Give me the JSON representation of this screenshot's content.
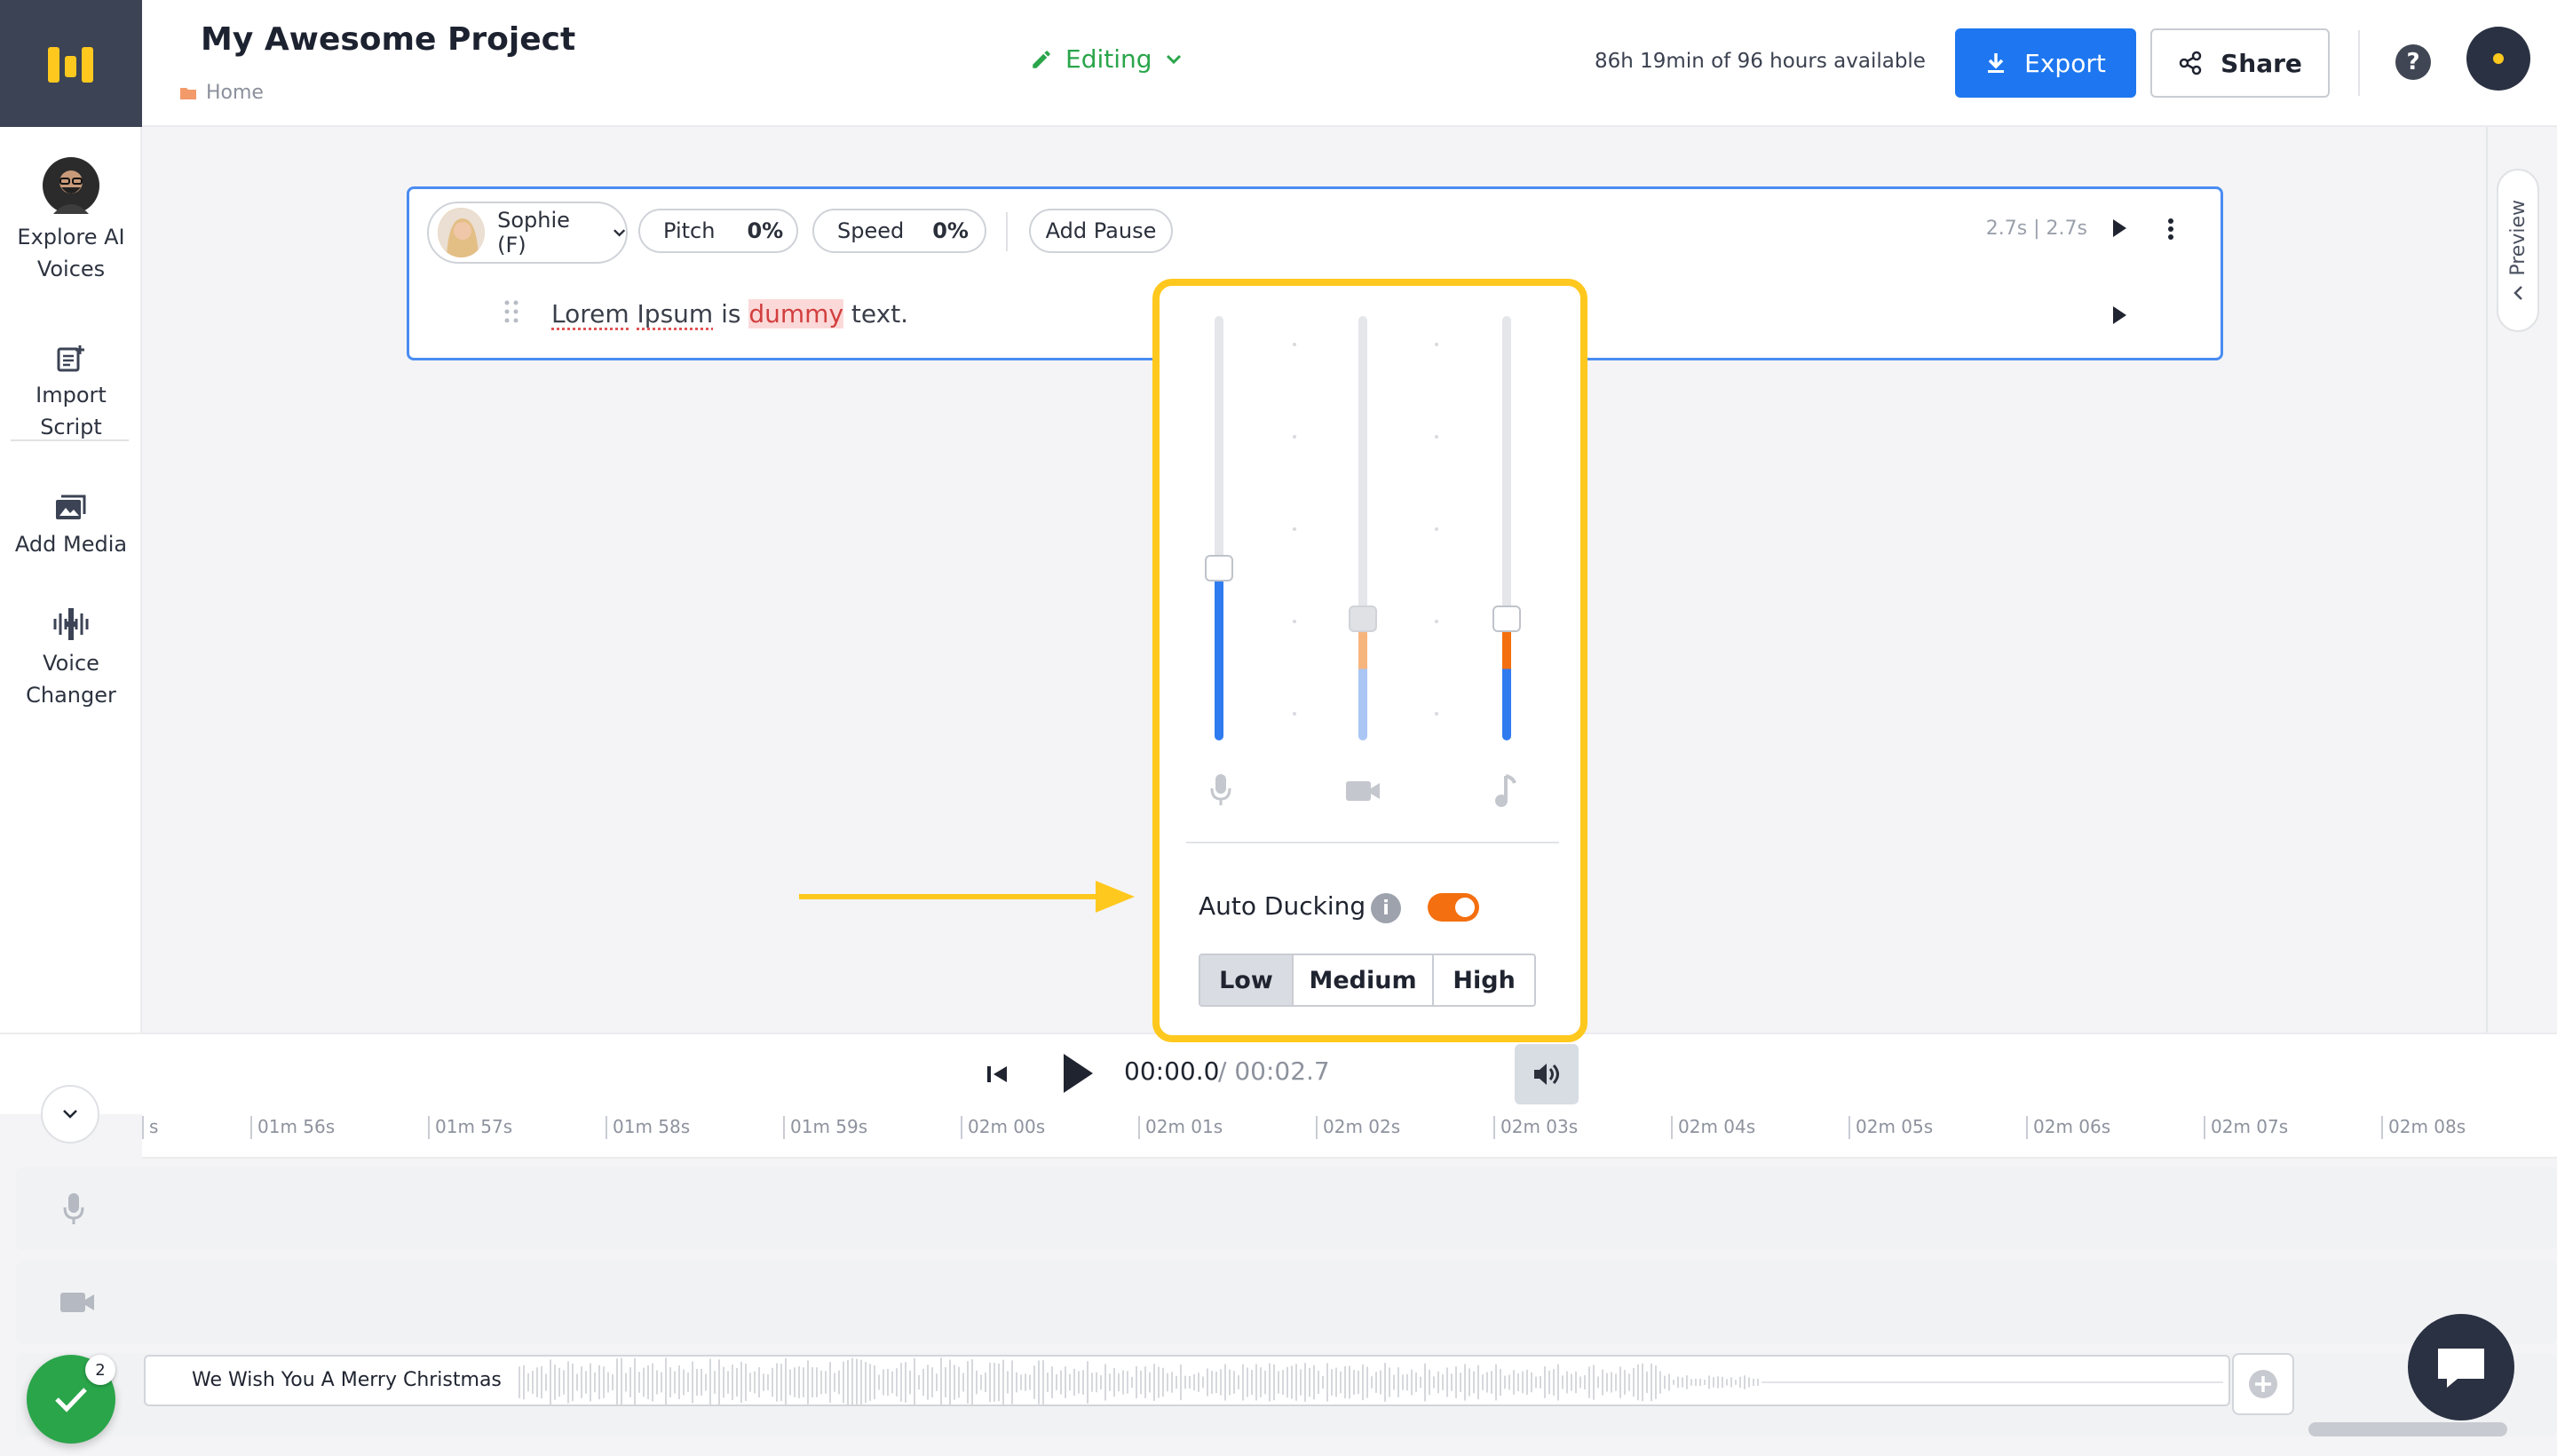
{
  "header": {
    "project_title": "My Awesome Project",
    "breadcrumb": "Home",
    "mode": "Editing",
    "hours_available": "86h 19min of 96 hours available",
    "export_label": "Export",
    "share_label": "Share",
    "help_label": "?"
  },
  "sidebar": {
    "items": [
      {
        "label": "Explore AI Voices",
        "icon": "voice-avatar"
      },
      {
        "label": "Import Script",
        "icon": "import-script-icon"
      },
      {
        "label": "Add Media",
        "icon": "add-media-icon"
      },
      {
        "label": "Voice Changer",
        "icon": "voice-changer-icon"
      }
    ]
  },
  "editor": {
    "voice": "Sophie (F)",
    "pitch_label": "Pitch",
    "pitch_value": "0%",
    "speed_label": "Speed",
    "speed_value": "0%",
    "add_pause_label": "Add Pause",
    "timing": "2.7s | 2.7s",
    "text_parts": [
      "Lorem",
      "Ipsum",
      "is",
      "dummy",
      "text."
    ]
  },
  "preview_tab": {
    "label": "Preview"
  },
  "player": {
    "time_current": "00:00.0",
    "time_total": "/ 00:02.7"
  },
  "timeline": {
    "ticks": [
      "s",
      "01m 56s",
      "01m 57s",
      "01m 58s",
      "01m 59s",
      "02m 00s",
      "02m 01s",
      "02m 02s",
      "02m 03s",
      "02m 04s",
      "02m 05s",
      "02m 06s",
      "02m 07s",
      "02m 08s"
    ],
    "music_clip": "We Wish You A Merry Christmas",
    "notification_count": "2"
  },
  "mixer": {
    "channels": [
      {
        "name": "voice",
        "icon": "microphone-icon",
        "level": 0.4
      },
      {
        "name": "video",
        "icon": "video-camera-icon",
        "level": 0.28
      },
      {
        "name": "music",
        "icon": "music-note-icon",
        "level": 0.28
      }
    ],
    "auto_ducking_label": "Auto Ducking",
    "auto_ducking_enabled": true,
    "levels": [
      "Low",
      "Medium",
      "High"
    ],
    "selected_level": "Low"
  },
  "colors": {
    "accent_blue": "#1e77f0",
    "editing_green": "#2aa54a",
    "highlight_yellow": "#ffc81e",
    "toggle_orange": "#f46f0f"
  }
}
